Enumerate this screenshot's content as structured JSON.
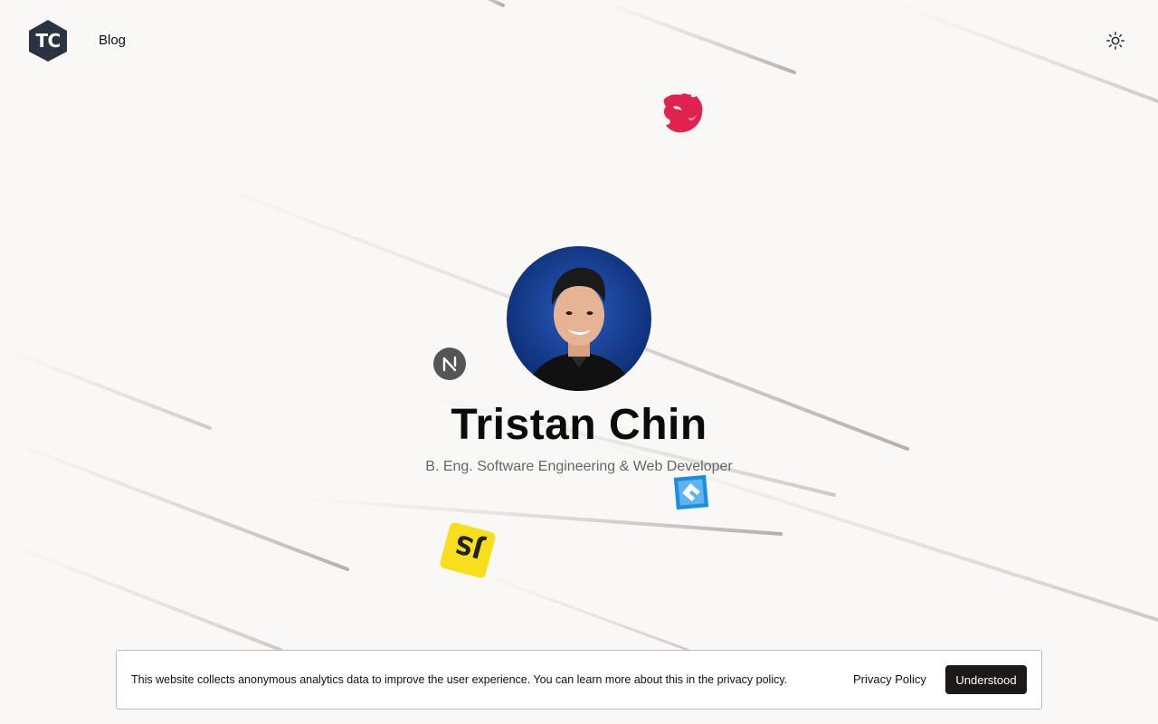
{
  "header": {
    "logo_text": "TC",
    "nav": {
      "blog_label": "Blog"
    }
  },
  "hero": {
    "name": "Tristan Chin",
    "subtitle": "B. Eng. Software Engineering & Web Developer"
  },
  "floating_icons": [
    "nestjs-icon",
    "nextjs-icon",
    "javascript-icon",
    "capacitor-icon"
  ],
  "cookie_banner": {
    "message": "This website collects anonymous analytics data to improve the user experience. You can learn more about this in the privacy policy.",
    "privacy_link_label": "Privacy Policy",
    "accept_label": "Understood"
  },
  "colors": {
    "background": "#f9f8f6",
    "logo": "#2b3240",
    "button": "#1c1917",
    "nestjs": "#e0234e",
    "javascript": "#f7df1e",
    "capacitor": "#1a8fe0"
  }
}
